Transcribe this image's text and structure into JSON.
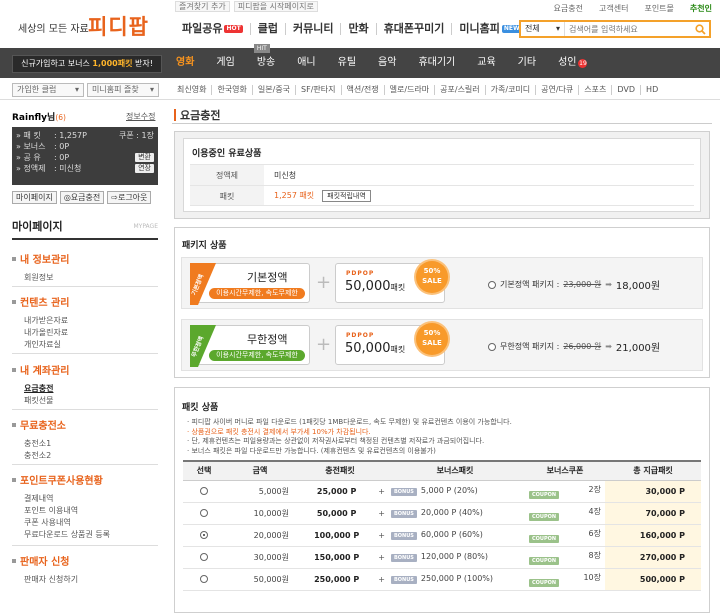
{
  "top": {
    "links": [
      "즐겨찾기 추가",
      "피디팝을 시작페이지로"
    ],
    "user_links": [
      "요금충전",
      "고객센터",
      "포인트몰",
      "추천인"
    ]
  },
  "brand": {
    "tagline": "세상의 모든 자료",
    "logo": "피디팝"
  },
  "main_nav": [
    {
      "label": "파일공유",
      "badge": "HOT"
    },
    {
      "label": "클럽",
      "badge": ""
    },
    {
      "label": "커뮤니티",
      "badge": ""
    },
    {
      "label": "만화",
      "badge": ""
    },
    {
      "label": "휴대폰꾸미기",
      "badge": ""
    },
    {
      "label": "미니홈피",
      "badge": "NEW"
    }
  ],
  "search": {
    "select": "전체",
    "placeholder": "검색어를 입력하세요"
  },
  "promo": {
    "pre": "신규가입하고 보너스 ",
    "amount": "1,000패킷",
    "post": " 받자!"
  },
  "cat_nav": [
    {
      "label": "영화",
      "active": true
    },
    {
      "label": "게임"
    },
    {
      "label": "방송",
      "tag": "HIT"
    },
    {
      "label": "애니"
    },
    {
      "label": "유틸"
    },
    {
      "label": "음악"
    },
    {
      "label": "휴대기기"
    },
    {
      "label": "교육"
    },
    {
      "label": "기타"
    },
    {
      "label": "성인",
      "count": "19"
    }
  ],
  "sub_selects": [
    "가입한 클럽",
    "미니홈피 즐찾"
  ],
  "sub_nav": [
    "최신영화",
    "한국영화",
    "일본/중국",
    "SF/판타지",
    "액션/전쟁",
    "멜로/드라마",
    "공포/스릴러",
    "가족/코미디",
    "공연/다큐",
    "스포츠",
    "DVD",
    "HD"
  ],
  "sidebar": {
    "user_name": "Rainfly님",
    "user_count": "(6)",
    "info_edit": "정보수정",
    "info": [
      {
        "key": "» 패  킷",
        "value": ": 1,257P",
        "extra": "쿠폰 : 1장"
      },
      {
        "key": "» 보너스",
        "value": ": 0P",
        "extra": ""
      },
      {
        "key": "» 공  유",
        "value": ": 0P",
        "btn": "변환"
      },
      {
        "key": "» 정액제",
        "value": ": 미신청",
        "btn": "연장"
      }
    ],
    "buttons": [
      "마이페이지",
      "요금충전",
      "로그아웃"
    ],
    "mypage_title": "마이페이지",
    "mypage_en": "MYPAGE",
    "sections": [
      {
        "title": "내 정보관리",
        "items": [
          "회원정보"
        ]
      },
      {
        "title": "컨텐츠 관리",
        "items": [
          "내가받은자료",
          "내가올린자료",
          "개인자료실"
        ]
      },
      {
        "title": "내 계좌관리",
        "items": [
          "요금충전",
          "패킷선물"
        ]
      },
      {
        "title": "무료충전소",
        "items": [
          "충전소1",
          "충전소2"
        ]
      },
      {
        "title": "포인트쿠폰사용현황",
        "items": [
          "결제내역",
          "포인트 이용내역",
          "쿠폰 사용내역",
          "무료다운로드 상품권 등록"
        ]
      },
      {
        "title": "판매자 신청",
        "items": [
          "판매자 신청하기"
        ]
      }
    ]
  },
  "main": {
    "page_title": "요금충전",
    "current": {
      "title": "이용중인 유료상품",
      "plan_label": "정액제",
      "plan_value": "미신청",
      "packet_label": "패킷",
      "packet_value": "1,257 패킷",
      "packet_btn": "패킷적립내역"
    },
    "packages": {
      "title": "패키지 상품",
      "items": [
        {
          "ribbon": "기본정액",
          "name": "기본정액",
          "desc": "이용시간무제한, 속도무제한",
          "packet_brand": "PDPOP",
          "packet": "50,000",
          "packet_unit": "패킷",
          "sale_pct": "50%",
          "sale_word": "SALE",
          "label": "기본정액 패키지 :",
          "old_price": "23,000 원",
          "new_price": "18,000원",
          "color": "#f07b1f"
        },
        {
          "ribbon": "무한정액",
          "name": "무한정액",
          "desc": "이용시간무제한, 속도무제한",
          "packet_brand": "PDPOP",
          "packet": "50,000",
          "packet_unit": "패킷",
          "sale_pct": "50%",
          "sale_word": "SALE",
          "label": "무한정액 패키지 :",
          "old_price": "26,000 원",
          "new_price": "21,000원",
          "color": "#5ba82d"
        }
      ]
    },
    "packets": {
      "title": "패킷 상품",
      "notes": [
        "· 피디팝 사이버 머니로 파일 다운로드 (1패킷당 1MB다운로드, 속도 무제한) 및 유료컨텐츠 이용이 가능합니다.",
        "· 상품권으로 패킷 충전시 결제에서 부가세 10%가 차감됩니다.",
        "· 단, 제휴컨텐츠는 피일용량과는 상관없이 저작권사로부터 책정된 컨텐츠별 저작료가 과금되어집니다.",
        "· 보너스 패킷은 파일 다운로드만 가능합니다. (제휴컨텐츠 및 유료컨텐츠의 이용불가)"
      ],
      "headers": [
        "선택",
        "금액",
        "충전패킷",
        "보너스패킷",
        "보너스쿠폰",
        "총 지급패킷"
      ],
      "bonus_chip": "BONUS",
      "coupon_chip": "COUPON",
      "plus": "+",
      "rows": [
        {
          "amount": "5,000원",
          "charge": "25,000 P",
          "bonus": "5,000 P (20%)",
          "coupon": "2장",
          "total": "30,000 P",
          "selected": false
        },
        {
          "amount": "10,000원",
          "charge": "50,000 P",
          "bonus": "20,000 P (40%)",
          "coupon": "4장",
          "total": "70,000 P",
          "selected": false
        },
        {
          "amount": "20,000원",
          "charge": "100,000 P",
          "bonus": "60,000 P (60%)",
          "coupon": "6장",
          "total": "160,000 P",
          "selected": true
        },
        {
          "amount": "30,000원",
          "charge": "150,000 P",
          "bonus": "120,000 P (80%)",
          "coupon": "8장",
          "total": "270,000 P",
          "selected": false
        },
        {
          "amount": "50,000원",
          "charge": "250,000 P",
          "bonus": "250,000 P (100%)",
          "coupon": "10장",
          "total": "500,000 P",
          "selected": false
        }
      ]
    }
  },
  "colors": {
    "accent": "#e8631c",
    "dark_bar": "#444444",
    "search_border": "#f4a12a",
    "sale": "#f89a2a"
  }
}
